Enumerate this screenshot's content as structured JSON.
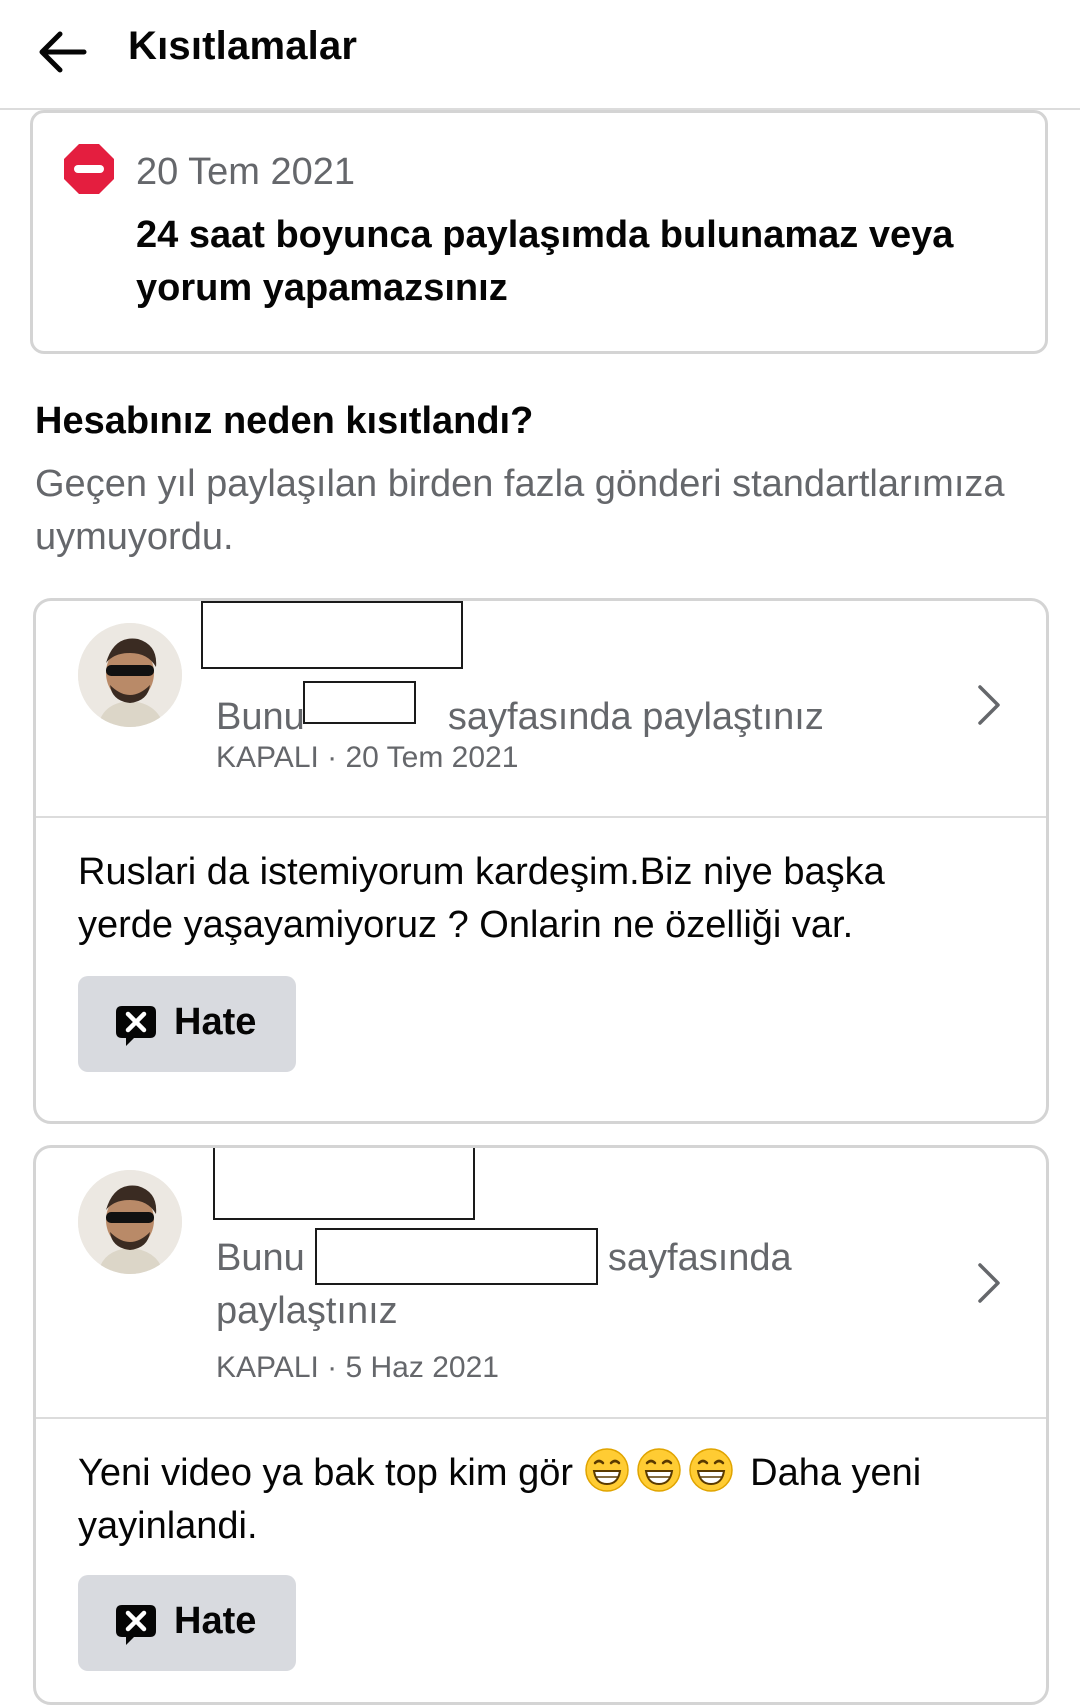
{
  "header": {
    "title": "Kısıtlamalar"
  },
  "restriction": {
    "date": "20 Tem 2021",
    "text": "24 saat boyunca paylaşımda bulunamaz veya yorum yapamazsınız"
  },
  "why": {
    "title": "Hesabınız neden kısıtlandı?",
    "text": "Geçen yıl paylaşılan birden fazla gönderi standartlarımıza uymuyordu."
  },
  "posts": [
    {
      "shared_prefix": "Bunu",
      "shared_suffix": "sayfasında paylaştınız",
      "meta": "KAPALI · 20 Tem 2021",
      "text": "Ruslari da istemiyorum kardeşim.Biz niye başka yerde yaşayamiyoruz ? Onlarin ne özelliği var.",
      "tag": "Hate"
    },
    {
      "shared_prefix": "Bunu",
      "shared_suffix": "sayfasında",
      "shared_line2": "paylaştınız",
      "meta": "KAPALI · 5 Haz 2021",
      "text_before": "Yeni video ya bak top kim gör",
      "text_after": "Daha yeni yayinlandi.",
      "tag": "Hate"
    }
  ],
  "colors": {
    "stop_red": "#e41e3f",
    "secondary_text": "#65676b",
    "tag_bg": "#d8dadf"
  },
  "icons": [
    "back-arrow-icon",
    "stop-icon",
    "chevron-right-icon",
    "grinning-emoji-icon",
    "hate-speech-icon"
  ]
}
